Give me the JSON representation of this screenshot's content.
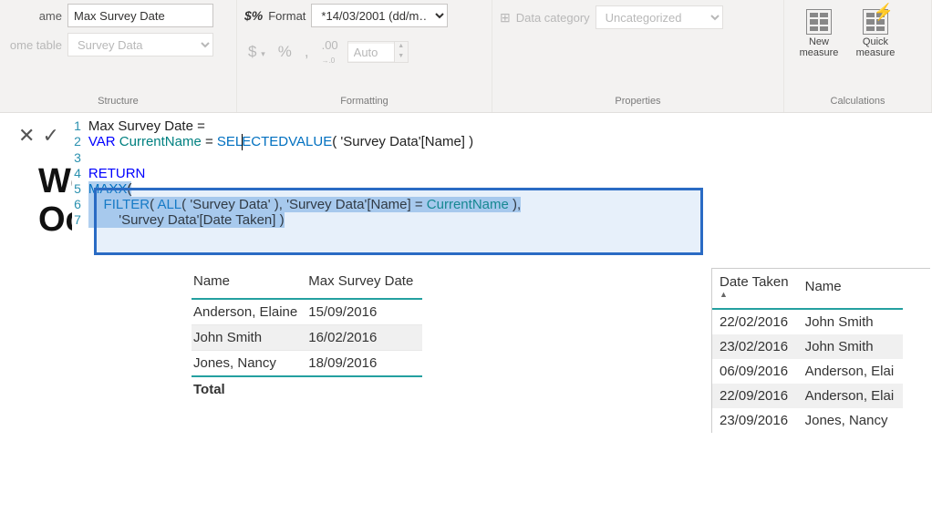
{
  "ribbon": {
    "structure": {
      "name_label": "ame",
      "name_value": "Max Survey Date",
      "home_table_label": "ome table",
      "home_table_value": "Survey Data",
      "group_label": "Structure"
    },
    "formatting": {
      "format_label": "Format",
      "format_value": "*14/03/2001 (dd/m…",
      "auto_label": "Auto",
      "group_label": "Formatting"
    },
    "properties": {
      "data_cat_label": "Data category",
      "data_cat_value": "Uncategorized",
      "group_label": "Properties"
    },
    "calculations": {
      "new_measure": "New\nmeasure",
      "quick_measure": "Quick\nmeasure",
      "group_label": "Calculations"
    }
  },
  "formula": {
    "lines": {
      "l1a": "Max Survey Date = ",
      "l2_var": "VAR",
      "l2_name": " CurrentName ",
      "l2_eq": "= ",
      "l2_fn": "SELECTEDVALUE",
      "l2_arg": "( 'Survey Data'[Name] )",
      "l4": "RETURN",
      "l5_fn": "MAXX",
      "l5_p": "(",
      "l6_a": "    ",
      "l6_fn1": "FILTER",
      "l6_b": "( ",
      "l6_fn2": "ALL",
      "l6_c": "( 'Survey Data' ), 'Survey Data'[Name] = ",
      "l6_var": "CurrentName",
      "l6_d": " ),",
      "l7_a": "        'Survey Data'[Date Taken] )"
    }
  },
  "bg": {
    "w1": "Wo",
    "w2": "Oc"
  },
  "table1": {
    "headers": [
      "Name",
      "Max Survey Date"
    ],
    "rows": [
      [
        "Anderson, Elaine",
        "15/09/2016"
      ],
      [
        "John Smith",
        "16/02/2016"
      ],
      [
        "Jones, Nancy",
        "18/09/2016"
      ]
    ],
    "total_label": "Total"
  },
  "table2": {
    "headers": [
      "Date Taken",
      "Name"
    ],
    "rows": [
      [
        "22/02/2016",
        "John Smith"
      ],
      [
        "23/02/2016",
        "John Smith"
      ],
      [
        "06/09/2016",
        "Anderson, Elai"
      ],
      [
        "22/09/2016",
        "Anderson, Elai"
      ],
      [
        "23/09/2016",
        "Jones, Nancy"
      ]
    ]
  }
}
